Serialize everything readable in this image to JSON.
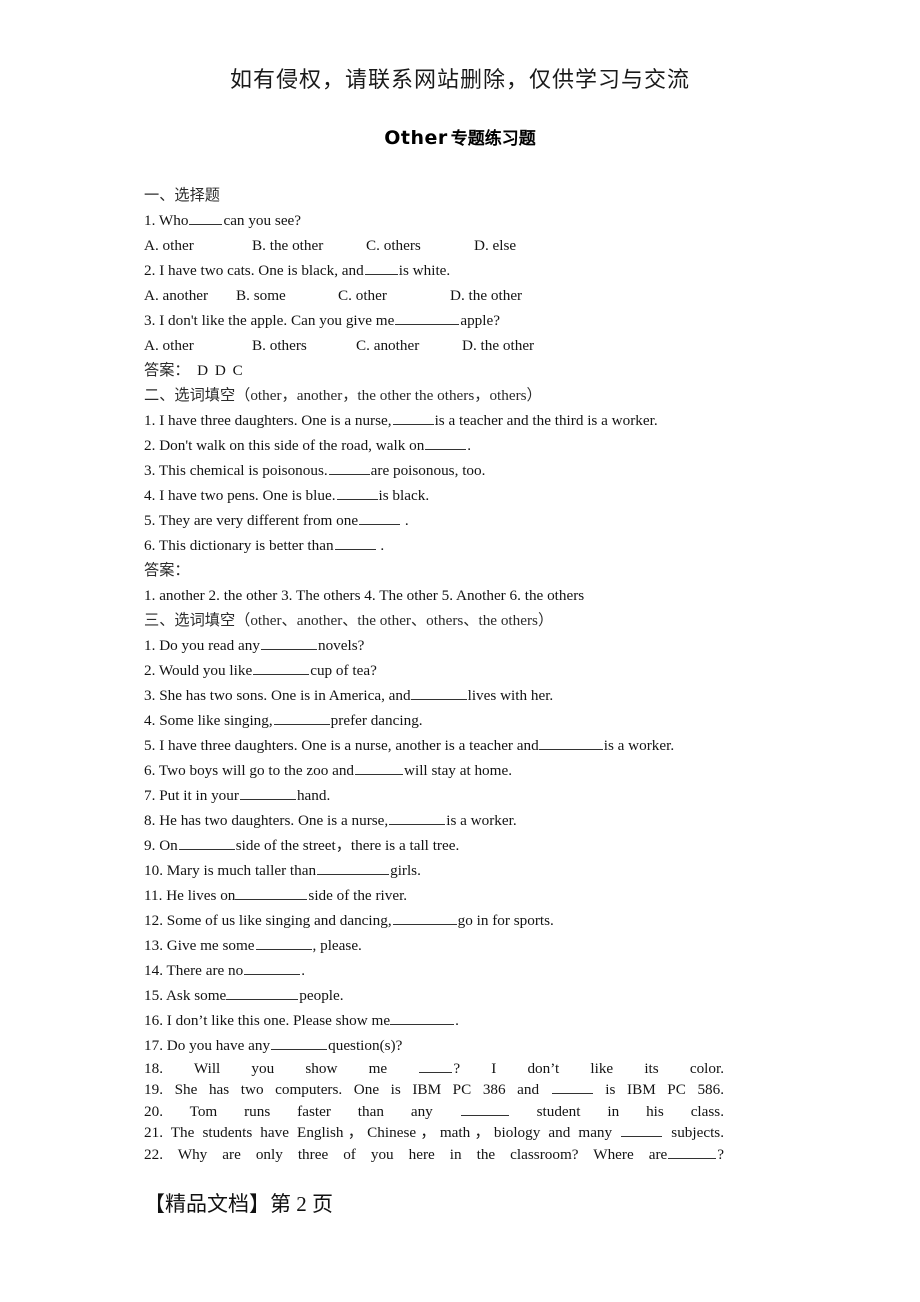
{
  "header": {
    "notice": "如有侵权，请联系网站删除，仅供学习与交流"
  },
  "title": {
    "latin": "Other",
    "cjk": "专题练习题"
  },
  "sections": [
    {
      "heading": "一、选择题",
      "questions": [
        {
          "number": "1.",
          "before": "Who",
          "blank": 4,
          "after": "can you see?"
        },
        {
          "number": "2.",
          "before": "I have two cats. One is black, and",
          "blank": 4,
          "after": "is white."
        },
        {
          "number": "3.",
          "before": "I don't like the apple. Can you give me",
          "blank": 8,
          "after": "apple?"
        }
      ],
      "options": [
        [
          "A. other",
          "B. the other",
          "C. others",
          "D. else"
        ],
        [
          "A. another",
          "B. some",
          "C. other",
          "D. the other"
        ],
        [
          "A. other",
          "B. others",
          "C. another",
          "D. the other"
        ]
      ],
      "answer_label": "答案：",
      "answer_value": "D D C"
    },
    {
      "heading": "二、选词填空（other，another，the other the others，others）",
      "questions": [
        {
          "number": "1.",
          "before": "I have three daughters. One is a nurse,",
          "blank": 5,
          "after": "is a teacher and the third is a worker."
        },
        {
          "number": "2.",
          "before": "Don't walk on this side of the road, walk on",
          "blank": 5,
          "after": "."
        },
        {
          "number": "3.",
          "before": "This chemical is poisonous.",
          "blank": 5,
          "after": "are poisonous, too."
        },
        {
          "number": "4.",
          "before": "I have two pens. One is blue.",
          "blank": 5,
          "after": "is black."
        },
        {
          "number": "5.",
          "before": "They are very different from one",
          "blank": 5,
          "after": "."
        },
        {
          "number": "6.",
          "before": "This dictionary is better than",
          "blank": 5,
          "after": "."
        }
      ],
      "answer_label": "答案：",
      "answer_value": "1. another 2. the other 3. The others 4. The other 5. Another 6. the others"
    },
    {
      "heading": "三、选词填空（other、another、the other、others、the others）",
      "questions": [
        {
          "number": "1.",
          "before": "Do you read any",
          "blank": 7,
          "after": "novels?"
        },
        {
          "number": "2.",
          "before": "Would you like",
          "blank": 7,
          "after": "cup of tea?"
        },
        {
          "number": "3.",
          "before": "She has two sons. One is in America, and",
          "blank": 7,
          "after": "lives with her."
        },
        {
          "number": "4.",
          "before": "Some like singing,",
          "blank": 7,
          "after": "prefer dancing."
        },
        {
          "number": "5.",
          "before": "I have three daughters. One is a nurse, another is a teacher and",
          "blank": 8,
          "after": "is a worker."
        },
        {
          "number": "6.",
          "before": "Two boys will go to the zoo and",
          "blank": 6,
          "after": "will stay at home."
        },
        {
          "number": "7.",
          "before": "Put it in your",
          "blank": 7,
          "after": "hand."
        },
        {
          "number": "8.",
          "before": "He has two daughters. One is a nurse,",
          "blank": 7,
          "after": "is a worker."
        },
        {
          "number": "9.",
          "before": "On",
          "blank": 7,
          "after": "side of the street，there is a tall tree."
        },
        {
          "number": "10.",
          "before": "Mary is much taller than",
          "blank": 9,
          "after": "girls."
        },
        {
          "number": "11.",
          "before": "He lives on",
          "blank": 9,
          "after": "side of the river."
        },
        {
          "number": "12.",
          "before": "Some of us like singing and dancing,",
          "blank": 8,
          "after": "go in for sports."
        },
        {
          "number": "13.",
          "before": "Give me some",
          "blank": 7,
          "after": ", please."
        },
        {
          "number": "14.",
          "before": "There are no",
          "blank": 7,
          "after": "."
        },
        {
          "number": "15.",
          "before": "Ask some",
          "blank": 9,
          "after": "people."
        },
        {
          "number": "16.",
          "before": "I don’t like this one. Please show me",
          "blank": 8,
          "after": "."
        },
        {
          "number": "17.",
          "before": "Do you have any",
          "blank": 7,
          "after": "question(s)?"
        }
      ],
      "justified_questions": [
        {
          "number": "18.",
          "before": "Will you show me",
          "blank": 4,
          "after": "? I don’t like its color."
        },
        {
          "number": "19.",
          "before": "She has two computers. One is IBM PC 386 and",
          "blank": 5,
          "after": "is IBM PC 586."
        },
        {
          "number": "20.",
          "before": "Tom runs faster than any",
          "blank": 6,
          "after": "student in his class."
        },
        {
          "number": "21.",
          "before": "The students have English，Chinese，math，biology and many",
          "blank": 5,
          "after": "subjects."
        },
        {
          "number": "22.",
          "before": "Why are only three of you here in the classroom? Where are",
          "blank": 6,
          "after": "?"
        }
      ]
    }
  ],
  "footer": {
    "text": "【精品文档】第 2 页"
  }
}
